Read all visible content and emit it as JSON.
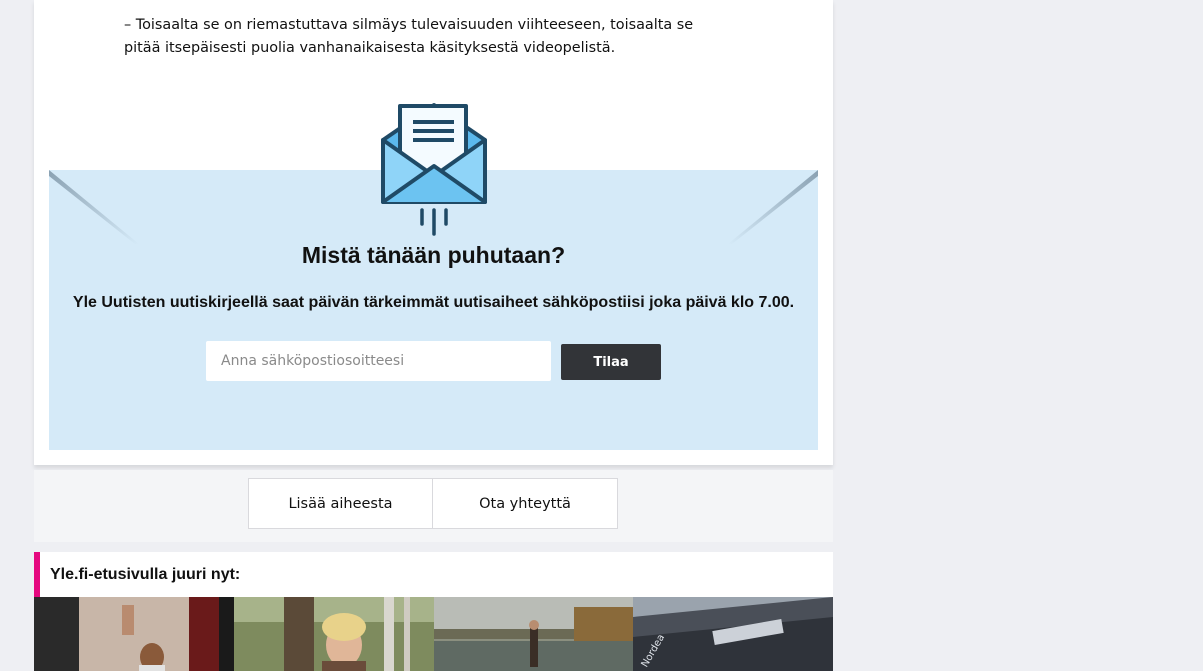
{
  "article": {
    "quote": "– Toisaalta se on riemastuttava silmäys tulevaisuuden viihteeseen, toisaalta se pitää itsepäisesti puolia vanhanaikaisesta käsityksestä videopelistä."
  },
  "newsletter": {
    "title": "Mistä tänään puhutaan?",
    "description": "Yle Uutisten uutiskirjeellä saat päivän tärkeimmät uutisaiheet sähköpostiisi joka päivä klo 7.00.",
    "email_placeholder": "Anna sähköpostiosoitteesi",
    "email_value": "",
    "subscribe_label": "Tilaa",
    "icon": "envelope-icon"
  },
  "tabs": [
    {
      "label": "Lisää aiheesta"
    },
    {
      "label": "Ota yhteyttä"
    }
  ],
  "frontpage": {
    "title": "Yle.fi-etusivulla juuri nyt:",
    "accent_color": "#e5097f",
    "thumbnails": [
      {
        "name": "thumbnail-child"
      },
      {
        "name": "thumbnail-woman-forest"
      },
      {
        "name": "thumbnail-lake-walker"
      },
      {
        "name": "thumbnail-nordea-building",
        "sign_text": "Nordea"
      }
    ]
  },
  "colors": {
    "page_background": "#eeeff3",
    "newsletter_background": "#d5eaf8",
    "button_background": "#323438"
  }
}
